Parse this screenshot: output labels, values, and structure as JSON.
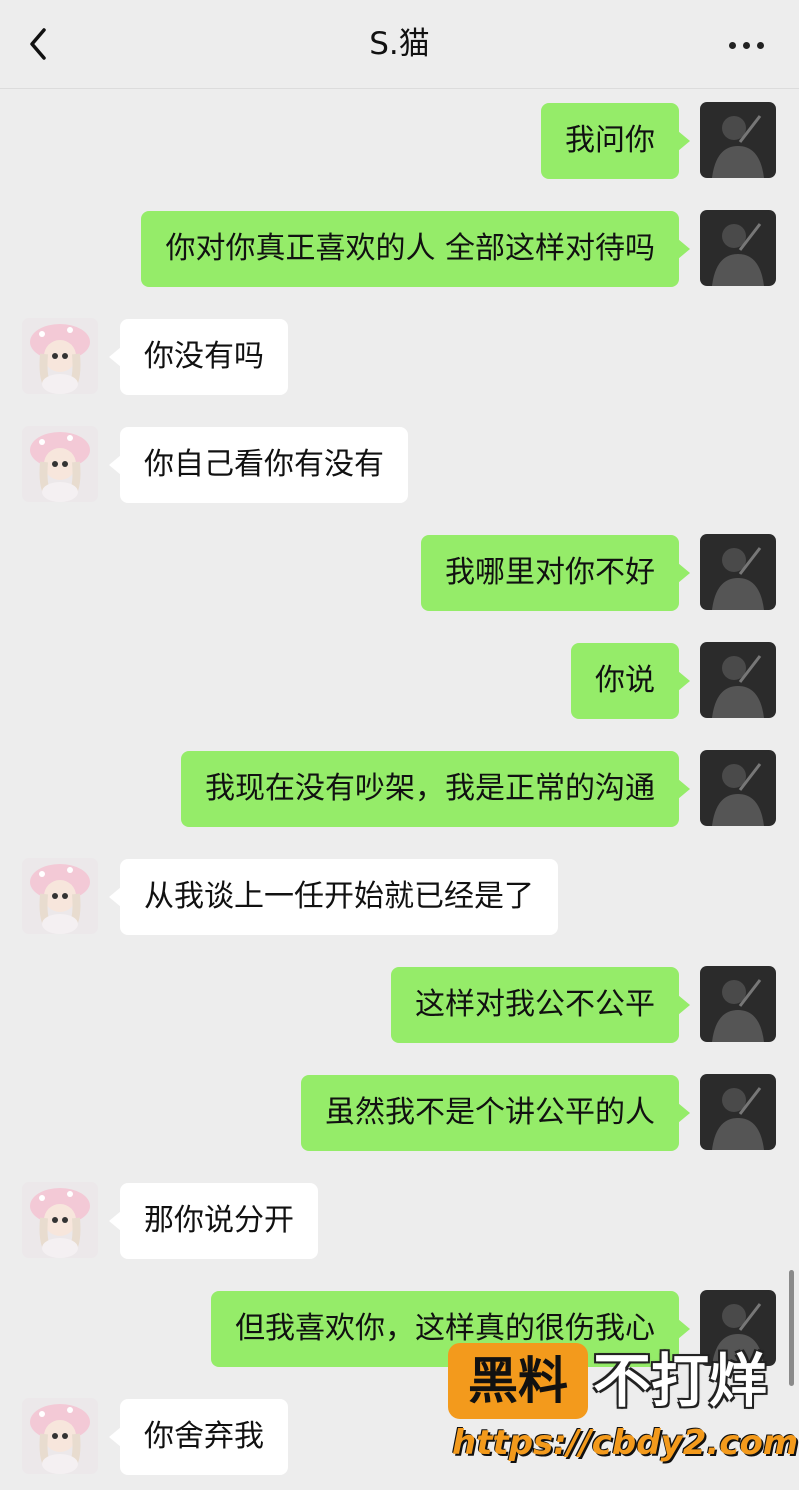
{
  "header": {
    "title": "S.猫",
    "back_icon": "chevron-left-icon",
    "more_icon": "more-dots-icon"
  },
  "messages": [
    {
      "side": "me",
      "text": "我问你"
    },
    {
      "side": "me",
      "text": "你对你真正喜欢的人 全部这样对待吗"
    },
    {
      "side": "other",
      "text": "你没有吗"
    },
    {
      "side": "other",
      "text": "你自己看你有没有"
    },
    {
      "side": "me",
      "text": "我哪里对你不好"
    },
    {
      "side": "me",
      "text": "你说"
    },
    {
      "side": "me",
      "text": "我现在没有吵架，我是正常的沟通"
    },
    {
      "side": "other",
      "text": "从我谈上一任开始就已经是了"
    },
    {
      "side": "me",
      "text": "这样对我公不公平"
    },
    {
      "side": "me",
      "text": "虽然我不是个讲公平的人"
    },
    {
      "side": "other",
      "text": "那你说分开"
    },
    {
      "side": "me",
      "text": "但我喜欢你，这样真的很伤我心"
    },
    {
      "side": "other",
      "text": "你舍弃我"
    }
  ],
  "watermark": {
    "badge": "黑料",
    "text": "不打烊",
    "url": "https://cbdy2.com"
  },
  "colors": {
    "background": "#ededed",
    "my_bubble": "#95ec69",
    "other_bubble": "#ffffff",
    "watermark_orange": "#f39a1c"
  }
}
